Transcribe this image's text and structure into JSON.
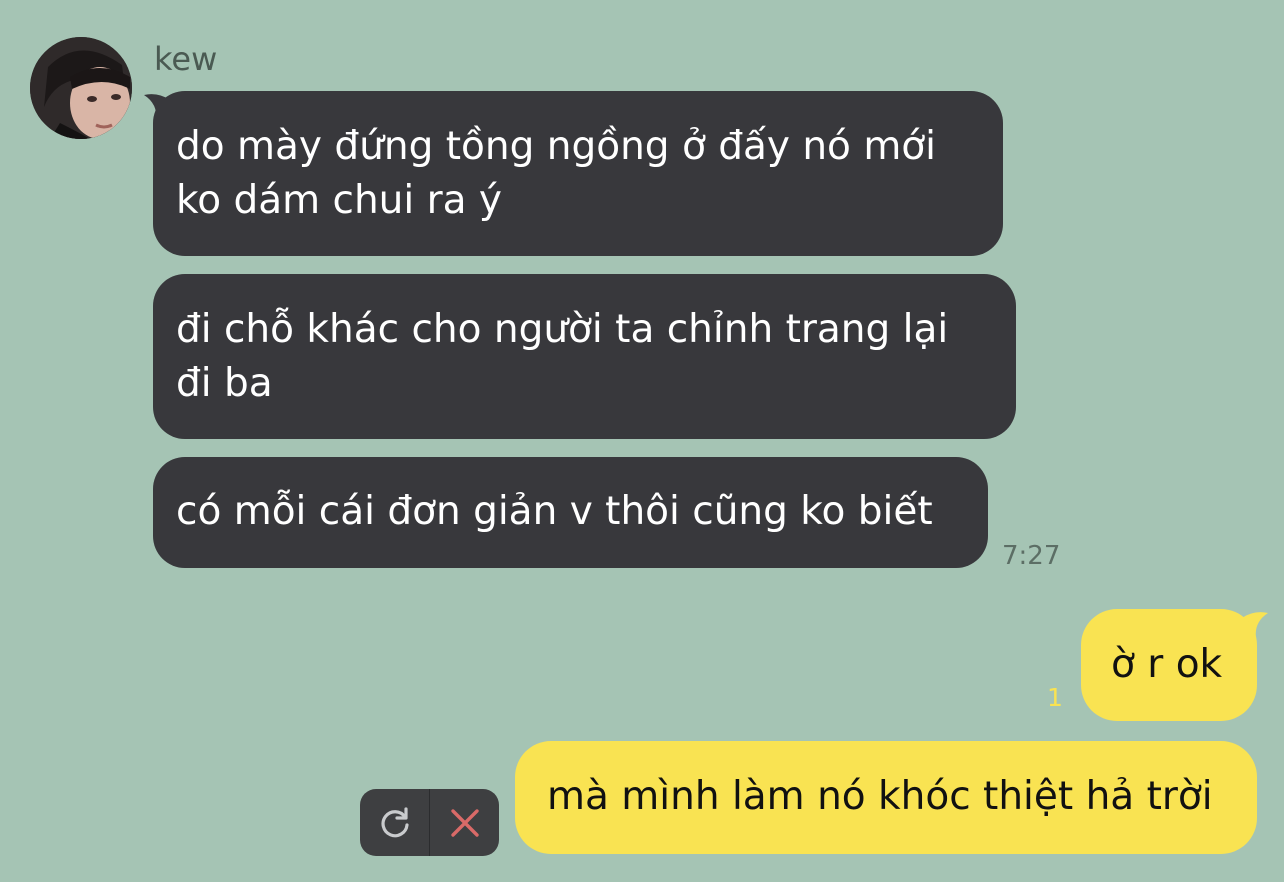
{
  "chat": {
    "sender": {
      "name": "kew"
    },
    "incoming": [
      {
        "lines": [
          "do mày đứng tồng ngồng ở đấy nó mới",
          "ko dám chui ra ý"
        ]
      },
      {
        "lines": [
          "đi chỗ khác cho người ta chỉnh trang lại",
          "đi ba"
        ]
      },
      {
        "lines": [
          "có mỗi cái đơn giản v thôi cũng ko biết"
        ]
      }
    ],
    "incoming_time": "7:27",
    "outgoing": [
      {
        "text": "ờ r ok",
        "read_count": "1"
      },
      {
        "text": "mà mình làm nó khóc thiệt hả trời",
        "status": "failed"
      }
    ],
    "failed_actions": {
      "retry_icon": "retry-icon",
      "delete_icon": "close-icon"
    }
  },
  "colors": {
    "background": "#a5c4b4",
    "incoming_bubble": "#38383c",
    "outgoing_bubble": "#f9e352",
    "delete_red": "#d96a68"
  }
}
